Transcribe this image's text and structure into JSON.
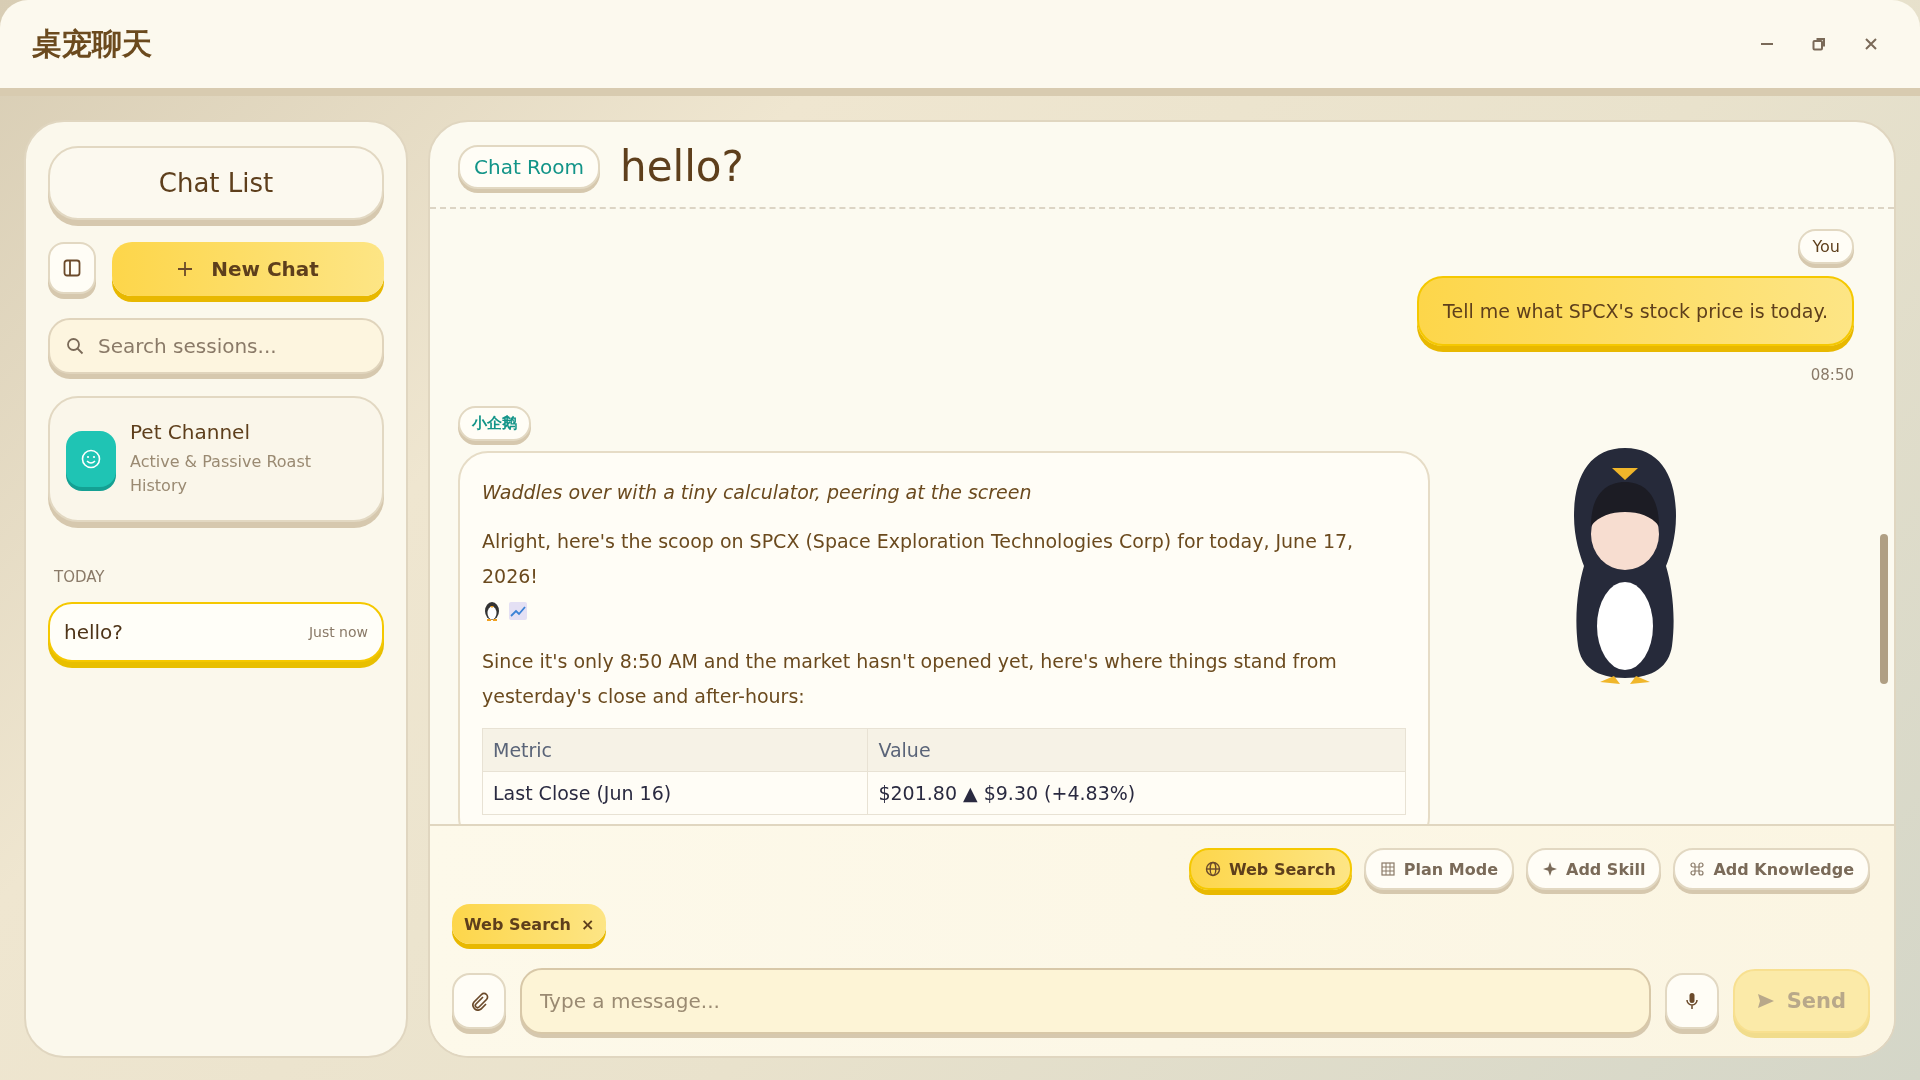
{
  "window": {
    "title": "桌宠聊天"
  },
  "sidebar": {
    "heading": "Chat List",
    "new_chat": "New Chat",
    "search": {
      "placeholder": "Search sessions..."
    },
    "channel": {
      "name": "Pet Channel",
      "description": "Active & Passive Roast History"
    },
    "section": "TODAY",
    "sessions": [
      {
        "title": "hello?",
        "time": "Just now",
        "selected": true
      }
    ]
  },
  "chat": {
    "badge": "Chat Room",
    "title": "hello?",
    "messages": [
      {
        "kind": "user",
        "sender": "You",
        "time": "08:50",
        "text": "Tell me what SPCX's stock price is today."
      },
      {
        "kind": "assistant",
        "sender": "小企鹅",
        "paragraphs": [
          {
            "kind": "action",
            "text": "Waddles over with a tiny calculator, peering at the screen"
          },
          {
            "kind": "lead",
            "text": "Alright, here's the scoop on SPCX (Space Exploration Technologies Corp) for today, June 17, 2026!"
          },
          {
            "kind": "text",
            "text": "Since it's only 8:50 AM and the market hasn't opened yet, here's where things stand from yesterday's close and after-hours:"
          }
        ],
        "table": {
          "columns": [
            "Metric",
            "Value"
          ],
          "rows": [
            [
              "Last Close (Jun 16)",
              "$201.80 ▲ $9.30 (+4.83%)"
            ]
          ]
        }
      }
    ]
  },
  "composer": {
    "tools": [
      {
        "label": "Web Search",
        "selected": true
      },
      {
        "label": "Plan Mode",
        "selected": false
      },
      {
        "label": "Add Skill",
        "selected": false
      },
      {
        "label": "Add Knowledge",
        "selected": false
      }
    ],
    "chips": [
      {
        "label": "Web Search",
        "remove": "×"
      }
    ],
    "input": {
      "placeholder": "Type a message..."
    },
    "send": {
      "label": "Send",
      "disabled": true
    }
  }
}
